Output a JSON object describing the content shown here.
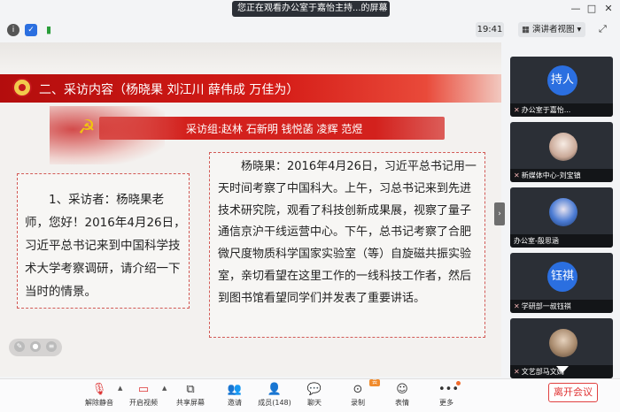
{
  "window": {
    "title": "您正在观看办公室于嘉怡主持...的屏幕",
    "minimize_glyph": "—",
    "maximize_glyph": "□",
    "close_glyph": "✕"
  },
  "infobar": {
    "timer": "19:41",
    "view_button": "演讲者视图",
    "icons": [
      "info-icon",
      "shield-icon",
      "signal-icon"
    ]
  },
  "slide": {
    "section_title": "二、采访内容（杨晓果 刘江川 薛伟成 万佳为）",
    "team": "采访组:赵林 石新明 钱悦菡 凌辉 范煜",
    "question": "1、采访者：杨晓果老师，您好！2016年4月26日，习近平总书记来到中国科学技术大学考察调研，请介绍一下当时的情景。",
    "answer": "杨晓果：2016年4月26日，习近平总书记用一天时间考察了中国科大。上午，习总书记来到先进技术研究院，观看了科技创新成果展，视察了量子通信京沪干线运营中心。下午，总书记考察了合肥微尺度物质科学国家实验室（等）自旋磁共振实验室，亲切看望在这里工作的一线科技工作者，然后到图书馆看望同学们并发表了重要讲话。"
  },
  "participants": [
    {
      "name": "办公室于嘉怡...",
      "avatar_text": "持人",
      "avatar_type": "circle",
      "avatar_color": "#2b6fe0"
    },
    {
      "name": "新媒体中心-刘宝镇",
      "avatar_text": "",
      "avatar_type": "photo",
      "avatar_color": "#e8d9cf"
    },
    {
      "name": "办公室-殷思涵",
      "avatar_text": "",
      "avatar_type": "photo",
      "avatar_color": "#3a7bd5"
    },
    {
      "name": "学研部一叔钰祺",
      "avatar_text": "钰祺",
      "avatar_type": "circle",
      "avatar_color": "#2b6fe0"
    },
    {
      "name": "文艺部马文嫣",
      "avatar_text": "",
      "avatar_type": "photo",
      "avatar_color": "#a98b6e"
    }
  ],
  "toolbar": {
    "buttons": [
      {
        "label": "解除静音",
        "icon": "mic-muted-icon"
      },
      {
        "label": "开启视频",
        "icon": "camera-off-icon"
      },
      {
        "label": "共享屏幕",
        "icon": "share-screen-icon"
      },
      {
        "label": "邀请",
        "icon": "invite-icon"
      },
      {
        "label": "成员(148)",
        "icon": "members-icon"
      },
      {
        "label": "聊天",
        "icon": "chat-icon"
      },
      {
        "label": "录制",
        "icon": "record-icon"
      },
      {
        "label": "表情",
        "icon": "emoji-icon"
      },
      {
        "label": "更多",
        "icon": "more-icon"
      }
    ],
    "leave_label": "离开会议",
    "record_badge": "云"
  },
  "colors": {
    "accent_red": "#d3211d",
    "leave_red": "#e03333",
    "tile_bg": "#2b2f36"
  }
}
